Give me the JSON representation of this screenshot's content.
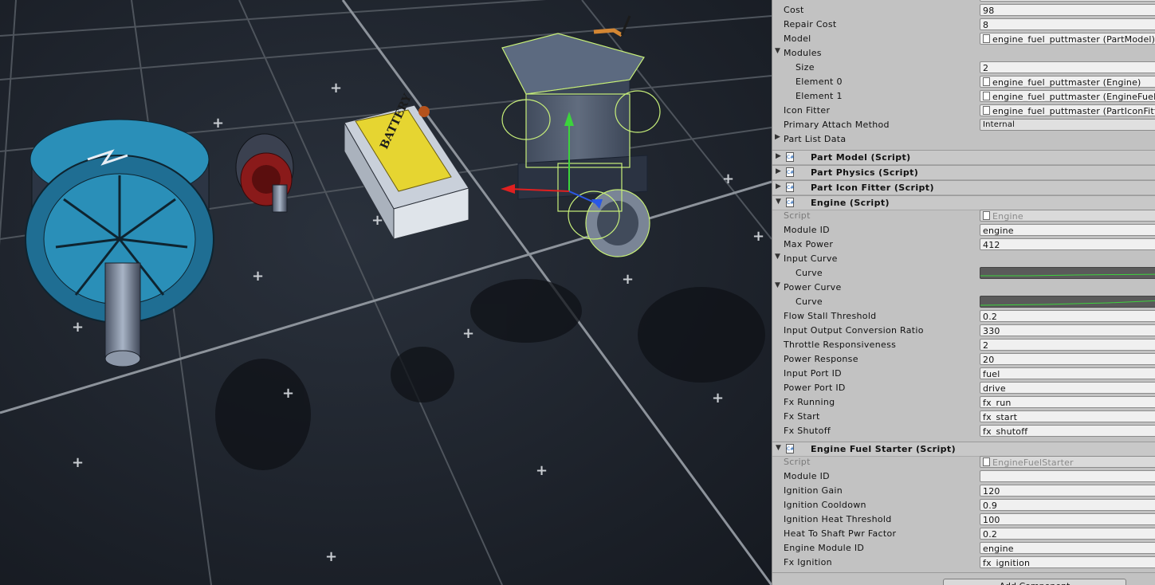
{
  "inspector": {
    "fields_top": [
      {
        "label": "Cost",
        "value": "98"
      },
      {
        "label": "Repair Cost",
        "value": "8"
      },
      {
        "label": "Model",
        "value": "engine_fuel_puttmaster (PartModel)"
      }
    ],
    "modules": {
      "label": "Modules",
      "size_label": "Size",
      "size_value": "2",
      "elements": [
        {
          "label": "Element 0",
          "value": "engine_fuel_puttmaster (Engine)"
        },
        {
          "label": "Element 1",
          "value": "engine_fuel_puttmaster (EngineFuelStarter)"
        }
      ]
    },
    "icon_fitter": {
      "label": "Icon Fitter",
      "value": "engine_fuel_puttmaster (PartIconFitter)"
    },
    "primary_attach": {
      "label": "Primary Attach Method",
      "value": "Internal"
    },
    "part_list_data": {
      "label": "Part List Data"
    },
    "components": [
      {
        "title": "Part Model (Script)"
      },
      {
        "title": "Part Physics (Script)"
      },
      {
        "title": "Part Icon Fitter (Script)"
      }
    ],
    "engine": {
      "title": "Engine (Script)",
      "script_label": "Script",
      "script_value": "Engine",
      "module_id_label": "Module ID",
      "module_id": "engine",
      "max_power_label": "Max Power",
      "max_power": "412",
      "input_curve_label": "Input Curve",
      "power_curve_label": "Power Curve",
      "curve_label": "Curve",
      "fields": [
        {
          "label": "Flow Stall Threshold",
          "value": "0.2"
        },
        {
          "label": "Input Output Conversion Ratio",
          "value": "330"
        },
        {
          "label": "Throttle Responsiveness",
          "value": "2"
        },
        {
          "label": "Power Response",
          "value": "20"
        },
        {
          "label": "Input Port ID",
          "value": "fuel"
        },
        {
          "label": "Power Port ID",
          "value": "drive"
        },
        {
          "label": "Fx Running",
          "value": "fx_run"
        },
        {
          "label": "Fx Start",
          "value": "fx_start"
        },
        {
          "label": "Fx Shutoff",
          "value": "fx_shutoff"
        }
      ]
    },
    "starter": {
      "title": "Engine Fuel Starter (Script)",
      "script_label": "Script",
      "script_value": "EngineFuelStarter",
      "fields": [
        {
          "label": "Module ID",
          "value": ""
        },
        {
          "label": "Ignition Gain",
          "value": "120"
        },
        {
          "label": "Ignition Cooldown",
          "value": "0.9"
        },
        {
          "label": "Ignition Heat Threshold",
          "value": "100"
        },
        {
          "label": "Heat To Shaft Pwr Factor",
          "value": "0.2"
        },
        {
          "label": "Engine Module ID",
          "value": "engine"
        },
        {
          "label": "Fx Ignition",
          "value": "fx_ignition"
        }
      ]
    },
    "add_component_label": "Add Component"
  },
  "viewport": {
    "battery_label": "BATTERY",
    "colors": {
      "background": "#1b2029",
      "grid": "#5b6068",
      "motor_blue": "#2a8fb8",
      "motor_red": "#8a1a1a",
      "battery_yellow": "#e6d531",
      "wire_green": "#c8f07a"
    }
  }
}
